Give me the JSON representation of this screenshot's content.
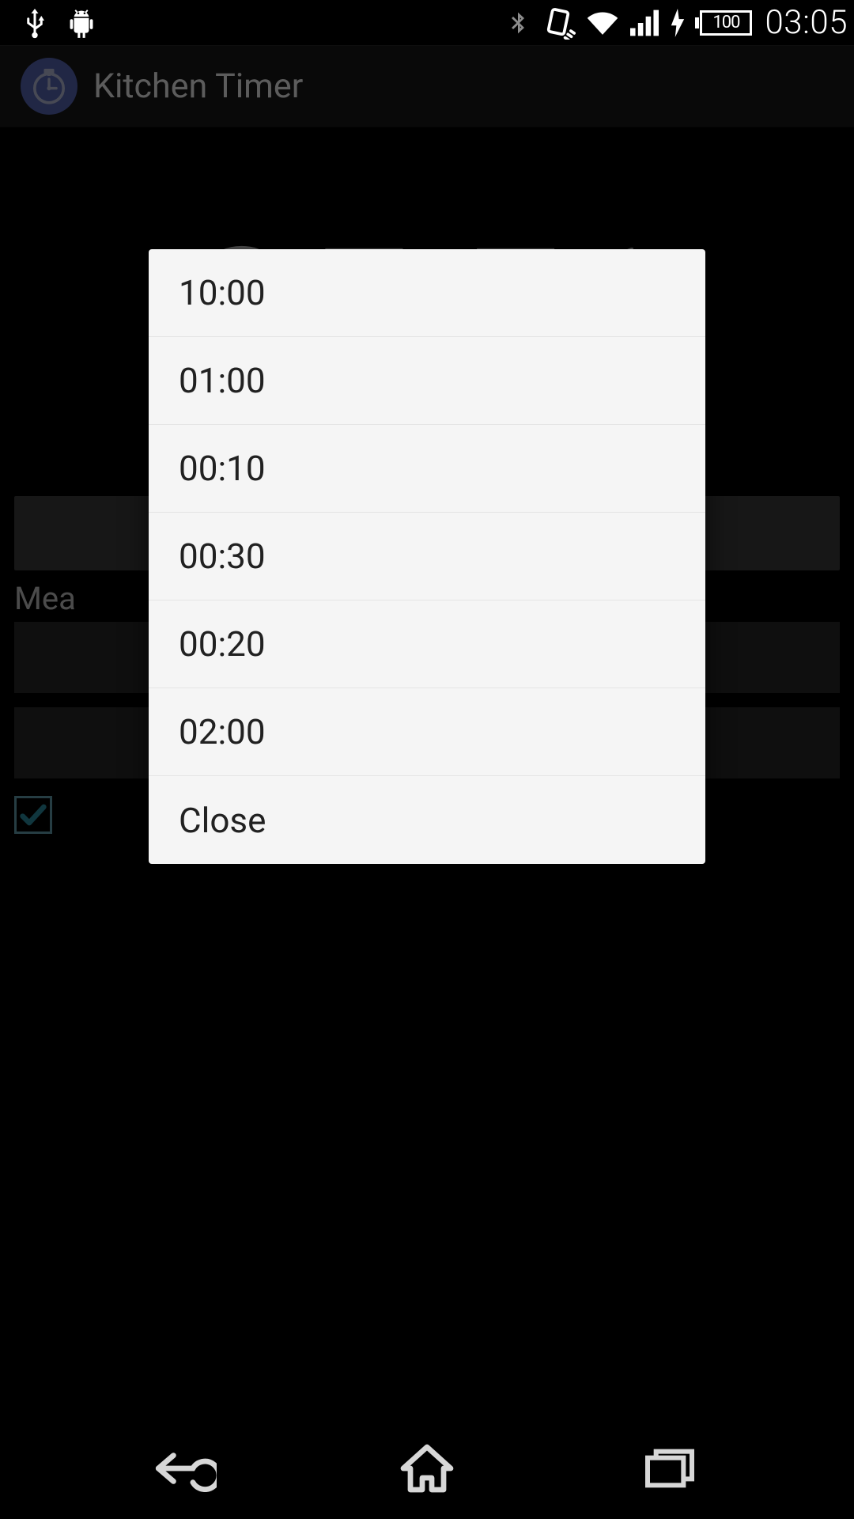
{
  "status_bar": {
    "time": "03:05",
    "battery_level": "100"
  },
  "app": {
    "title": "Kitchen Timer"
  },
  "timer": {
    "display": "05:51"
  },
  "background": {
    "label": "Mea"
  },
  "dialog": {
    "items": [
      "10:00",
      "01:00",
      "00:10",
      "00:30",
      "00:20",
      "02:00"
    ],
    "close_label": "Close"
  }
}
